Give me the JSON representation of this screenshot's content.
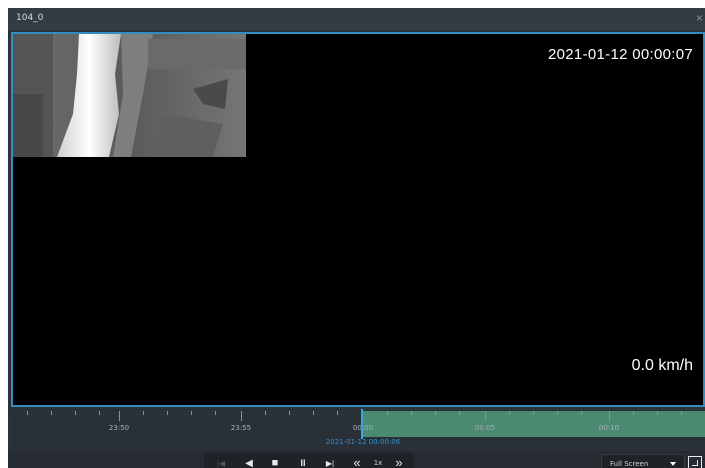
{
  "window": {
    "title": "104_0",
    "close_icon": "×"
  },
  "video": {
    "timestamp": "2021-01-12 00:00:07",
    "speed": "0.0 km/h",
    "thumbnail_icon": "video-frame-thumbnail"
  },
  "timeline": {
    "labels": [
      "23:50",
      "23:55",
      "00:00",
      "00:05",
      "00:10"
    ],
    "current_time": "2021-01-12 00:00:06",
    "played_color": "#4a8a70",
    "cursor_color": "#37a6e0"
  },
  "controls": {
    "first_frame": "|◀",
    "play_back": "◀",
    "stop": "■",
    "pause": "II",
    "step_forward": "▶|",
    "slower": "«",
    "speed_label": "1x",
    "faster": "»"
  },
  "view_mode": {
    "selected": "Full Screen"
  }
}
